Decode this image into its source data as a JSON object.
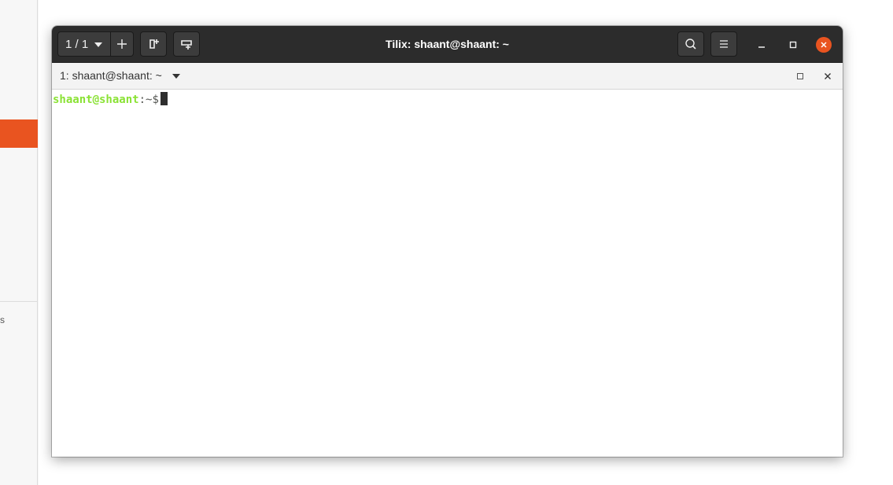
{
  "background": {
    "sidebar_fragment": "s",
    "accent_color": "#e95420"
  },
  "window": {
    "title": "Tilix: shaant@shaant: ~",
    "session_switcher": {
      "label": "1 / 1"
    },
    "icons": {
      "dropdown": "chevron-down-icon",
      "new_session": "plus-icon",
      "add_terminal_right": "split-right-icon",
      "add_terminal_down": "split-down-icon",
      "find": "search-icon",
      "menu": "hamburger-menu-icon",
      "minimize": "minimize-icon",
      "maximize": "maximize-icon",
      "close": "close-icon"
    },
    "close_color": "#e95420"
  },
  "terminal_tab": {
    "title": "1: shaant@shaant: ~",
    "icons": {
      "dropdown": "chevron-down-icon",
      "maximize": "maximize-icon",
      "close": "close-icon"
    }
  },
  "terminal": {
    "prompt_user": "shaant@shaant",
    "prompt_separator": ":",
    "prompt_path": "~$",
    "user_color": "#8ae234"
  }
}
